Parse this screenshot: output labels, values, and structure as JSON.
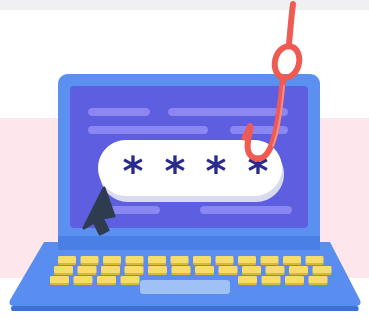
{
  "illustration": {
    "subject": "phishing-password-hook",
    "password_mask": [
      "*",
      "*",
      "*",
      "*"
    ],
    "colors": {
      "background_band": "#fde6ec",
      "laptop_body": "#5a8df0",
      "laptop_body_dark": "#3f6fd9",
      "screen_frame": "#5b8ff0",
      "screen": "#5d5fe0",
      "screen_lines": "#8a86f2",
      "password_pill": "#ffffff",
      "password_pill_shadow": "#e7e9f5",
      "asterisk": "#2a2a8e",
      "hook": "#ef5b52",
      "keys": "#f6dd6a",
      "key_shadow": "#d9b83a",
      "touchpad": "#9fc1f6",
      "cursor": "#2f3b4f"
    }
  }
}
